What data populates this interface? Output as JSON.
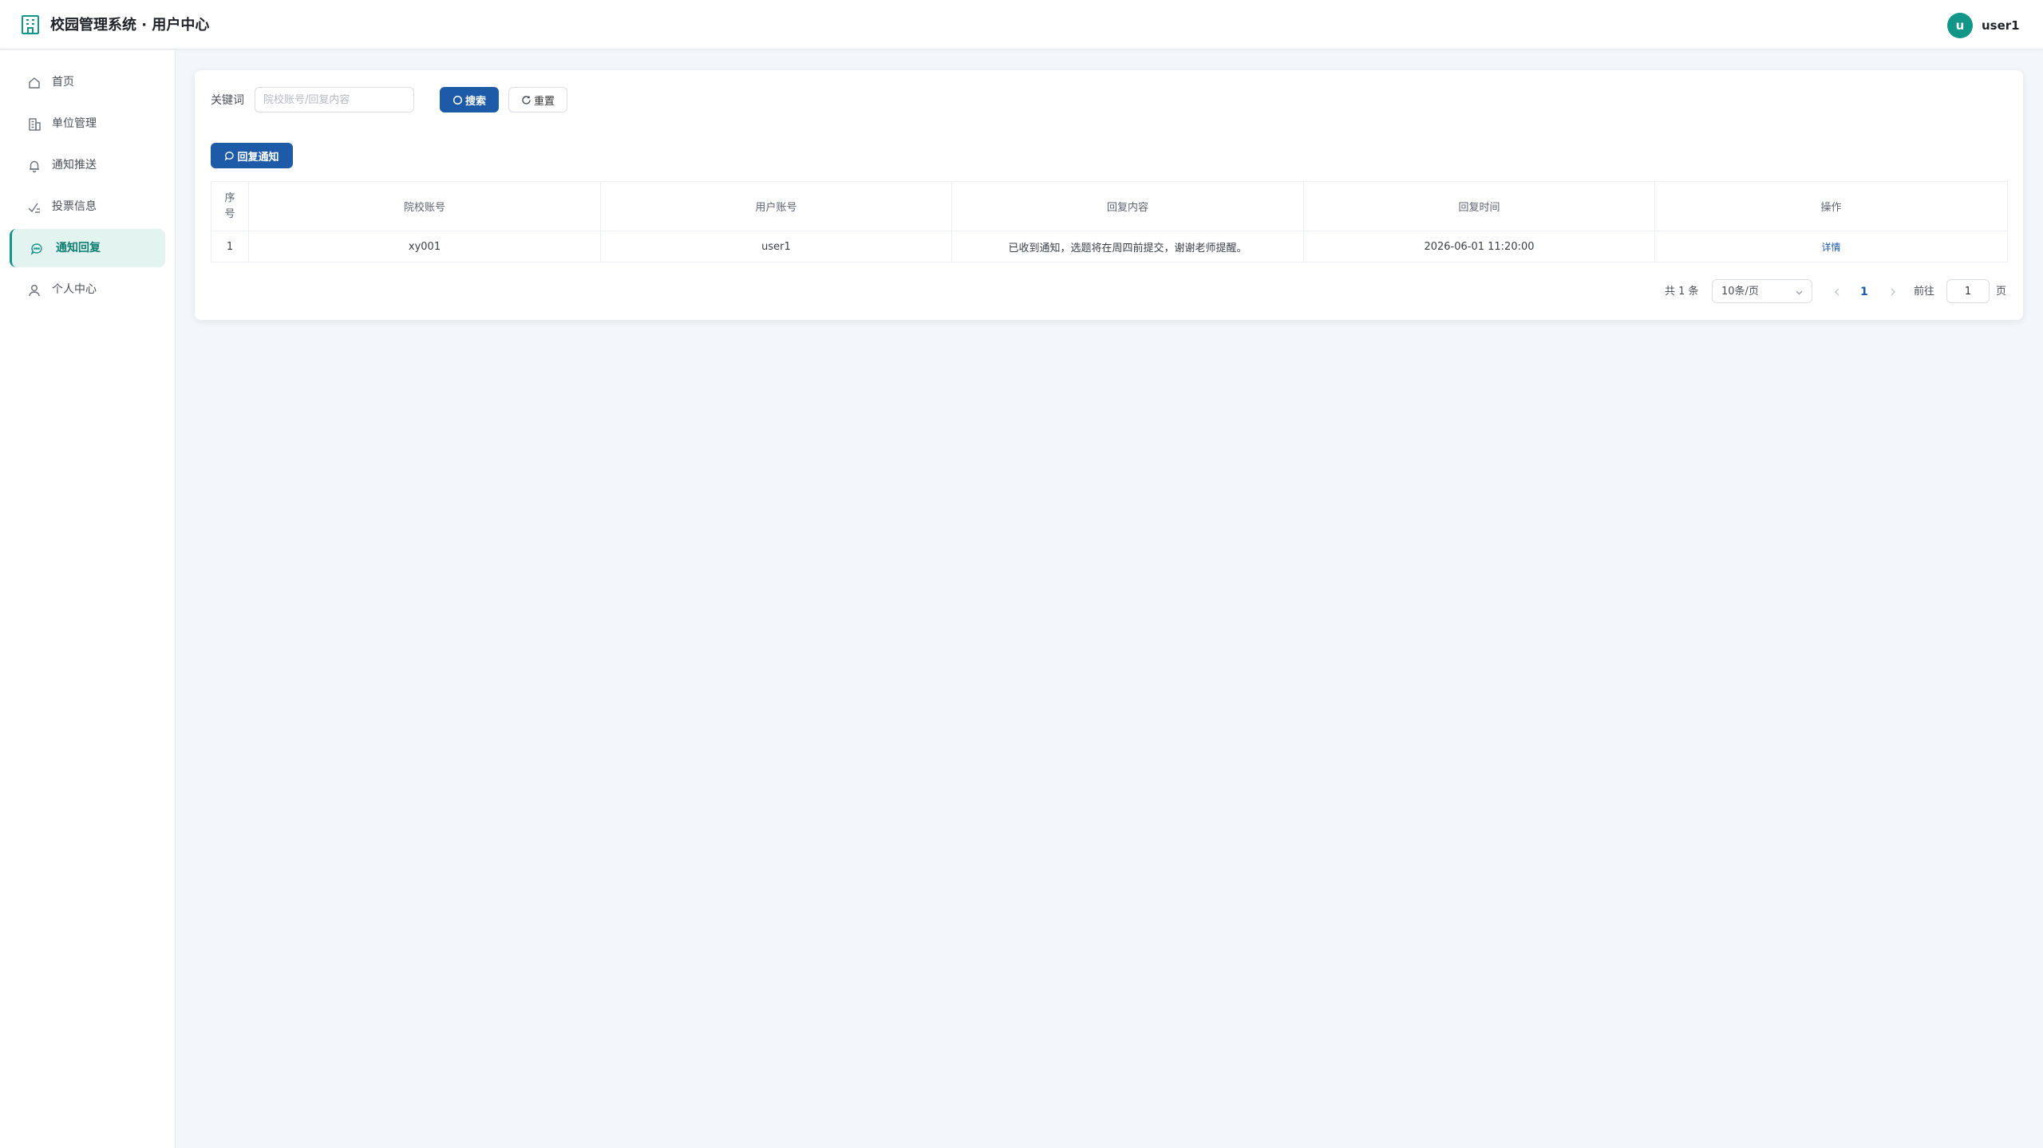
{
  "header": {
    "title": "校园管理系统 · 用户中心",
    "avatar_letter": "u",
    "username": "user1",
    "accent_color": "#129687"
  },
  "sidebar": {
    "items": [
      {
        "label": "首页",
        "icon": "home-icon"
      },
      {
        "label": "单位管理",
        "icon": "building-icon"
      },
      {
        "label": "通知推送",
        "icon": "bell-icon"
      },
      {
        "label": "投票信息",
        "icon": "vote-icon"
      },
      {
        "label": "通知回复",
        "icon": "chat-icon",
        "active": true
      },
      {
        "label": "个人中心",
        "icon": "user-icon"
      }
    ]
  },
  "search": {
    "label": "关键词",
    "placeholder": "院校账号/回复内容",
    "value": "",
    "search_label": "搜索",
    "reset_label": "重置"
  },
  "toolbar": {
    "reply_label": "回复通知"
  },
  "table": {
    "headers": [
      "序号",
      "院校账号",
      "用户账号",
      "回复内容",
      "回复时间",
      "操作"
    ],
    "rows": [
      {
        "index": "1",
        "school_account": "xy001",
        "user_account": "user1",
        "content": "已收到通知，选题将在周四前提交，谢谢老师提醒。",
        "time": "2026-06-01 11:20:00",
        "action": "详情"
      }
    ]
  },
  "pagination": {
    "total": "共 1 条",
    "page_size": "10条/页",
    "current_page": "1",
    "goto_label": "前往",
    "goto_value": "1",
    "page_suffix": "页"
  },
  "colors": {
    "primary": "#1d5aa8",
    "accent": "#129687",
    "background": "#f3f6fa"
  }
}
